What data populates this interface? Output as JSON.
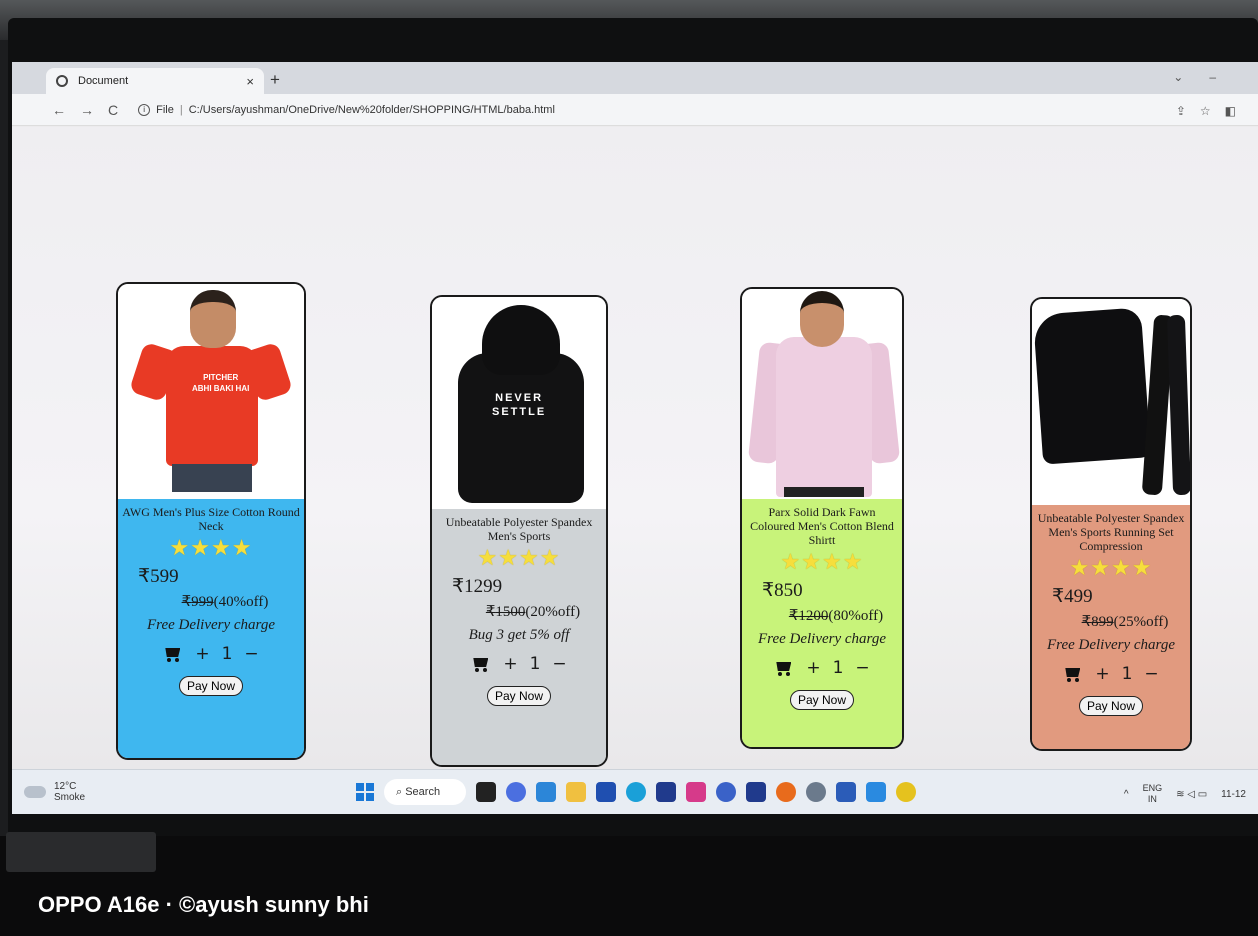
{
  "browser": {
    "tab_title": "Document",
    "tab_close": "×",
    "new_tab": "+",
    "url_scheme": "File",
    "url": "C:/Users/ayushman/OneDrive/New%20folder/SHOPPING/HTML/baba.html"
  },
  "currency": "₹",
  "products": [
    {
      "name": "AWG Men's Plus Size Cotton Round Neck",
      "stars": "★★★★",
      "price": "599",
      "mrp": "999",
      "discount": "(40%off)",
      "offer": "Free Delivery charge",
      "qty": "1",
      "pay_label": "Pay Now",
      "color": "#3fb7ef"
    },
    {
      "name": "Unbeatable Polyester Spandex Men's Sports",
      "stars": "★★★★",
      "price": "1299",
      "mrp": "1500",
      "discount": "(20%off)",
      "offer": "Bug 3 get 5% off",
      "qty": "1",
      "pay_label": "Pay Now",
      "color": "#cfd3d6"
    },
    {
      "name": "Parx Solid Dark Fawn Coloured Men's Cotton Blend Shirtt",
      "stars": "★★★★",
      "price": "850",
      "mrp": "1200",
      "discount": "(80%off)",
      "offer": "Free Delivery charge",
      "qty": "1",
      "pay_label": "Pay Now",
      "color": "#c8f37a"
    },
    {
      "name": "Unbeatable Polyester Spandex Men's Sports Running Set Compression",
      "stars": "★★★★",
      "price": "499",
      "mrp": "899",
      "discount": "(25%off)",
      "offer": "Free Delivery charge",
      "qty": "1",
      "pay_label": "Pay Now",
      "color": "#e19a7f"
    }
  ],
  "product_prints": {
    "tee_line1": "PITCHER",
    "tee_line2": "ABHI BAKI HAI",
    "hoodie_line1": "NEVER",
    "hoodie_line2": "SETTLE"
  },
  "taskbar": {
    "temperature": "12°C",
    "condition": "Smoke",
    "search_label": "Search",
    "lang_top": "ENG",
    "lang_bottom": "IN",
    "time": "11-12"
  },
  "photo_watermark": "OPPO A16e · ©ayush sunny bhi"
}
